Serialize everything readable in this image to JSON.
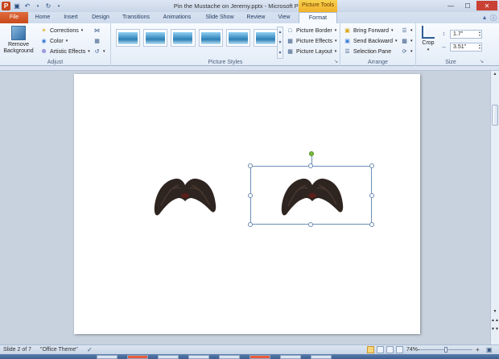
{
  "window": {
    "title": "Pin the Mustache on Jeremy.pptx - Microsoft PowerPoint",
    "context_tools": "Picture Tools"
  },
  "tabs": [
    {
      "label": "File"
    },
    {
      "label": "Home"
    },
    {
      "label": "Insert"
    },
    {
      "label": "Design"
    },
    {
      "label": "Transitions"
    },
    {
      "label": "Animations"
    },
    {
      "label": "Slide Show"
    },
    {
      "label": "Review"
    },
    {
      "label": "View"
    },
    {
      "label": "Format"
    }
  ],
  "ribbon": {
    "adjust": {
      "label": "Adjust",
      "remove_background": "Remove Background",
      "corrections": "Corrections",
      "color": "Color",
      "artistic_effects": "Artistic Effects"
    },
    "picture_styles": {
      "label": "Picture Styles",
      "picture_border": "Picture Border",
      "picture_effects": "Picture Effects",
      "picture_layout": "Picture Layout"
    },
    "arrange": {
      "label": "Arrange",
      "bring_forward": "Bring Forward",
      "send_backward": "Send Backward",
      "selection_pane": "Selection Pane"
    },
    "size": {
      "label": "Size",
      "crop": "Crop",
      "height": "1.7\"",
      "width": "3.51\""
    }
  },
  "status": {
    "slide": "Slide 2 of 7",
    "theme": "\"Office Theme\"",
    "zoom": "74%"
  },
  "colors": {
    "file_tab": "#c84a1c",
    "picture_tools": "#f1b12a",
    "selection": "#6c8fb8",
    "rotation_handle": "#7bbd3c",
    "mustache": "#2e2420"
  }
}
